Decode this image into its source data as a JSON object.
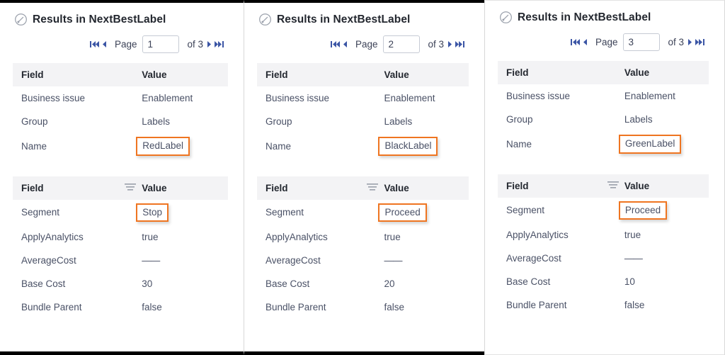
{
  "colors": {
    "highlight_border": "#ef7521",
    "header_bg": "#f3f3f5",
    "accent_blue": "#3b55a5",
    "text": "#4a5166"
  },
  "icons": {
    "gauge": "gauge-icon",
    "filter": "filter-icon",
    "first_page": "first-page-icon",
    "prev_page": "prev-page-icon",
    "next_page": "next-page-icon",
    "last_page": "last-page-icon"
  },
  "pager_common": {
    "page_label": "Page",
    "of_label": "of 3",
    "page_placeholder": ""
  },
  "table_headers": {
    "field": "Field",
    "value": "Value"
  },
  "panels": [
    {
      "title": "Results in NextBestLabel",
      "page_value": "1",
      "top_table": {
        "rows": [
          {
            "field": "Business issue",
            "value": "Enablement",
            "highlight": false
          },
          {
            "field": "Group",
            "value": "Labels",
            "highlight": false
          },
          {
            "field": "Name",
            "value": "RedLabel",
            "highlight": true
          }
        ]
      },
      "bottom_table": {
        "rows": [
          {
            "field": "Segment",
            "value": "Stop",
            "highlight": true
          },
          {
            "field": "ApplyAnalytics",
            "value": "true",
            "highlight": false
          },
          {
            "field": "AverageCost",
            "value": "——",
            "highlight": false
          },
          {
            "field": "Base Cost",
            "value": "30",
            "highlight": false
          },
          {
            "field": "Bundle Parent",
            "value": "false",
            "highlight": false
          }
        ]
      }
    },
    {
      "title": "Results in NextBestLabel",
      "page_value": "2",
      "top_table": {
        "rows": [
          {
            "field": "Business issue",
            "value": "Enablement",
            "highlight": false
          },
          {
            "field": "Group",
            "value": "Labels",
            "highlight": false
          },
          {
            "field": "Name",
            "value": "BlackLabel",
            "highlight": true
          }
        ]
      },
      "bottom_table": {
        "rows": [
          {
            "field": "Segment",
            "value": "Proceed",
            "highlight": true
          },
          {
            "field": "ApplyAnalytics",
            "value": "true",
            "highlight": false
          },
          {
            "field": "AverageCost",
            "value": "——",
            "highlight": false
          },
          {
            "field": "Base Cost",
            "value": "20",
            "highlight": false
          },
          {
            "field": "Bundle Parent",
            "value": "false",
            "highlight": false
          }
        ]
      }
    },
    {
      "title": "Results in NextBestLabel",
      "page_value": "3",
      "top_table": {
        "rows": [
          {
            "field": "Business issue",
            "value": "Enablement",
            "highlight": false
          },
          {
            "field": "Group",
            "value": "Labels",
            "highlight": false
          },
          {
            "field": "Name",
            "value": "GreenLabel",
            "highlight": true
          }
        ]
      },
      "bottom_table": {
        "rows": [
          {
            "field": "Segment",
            "value": "Proceed",
            "highlight": true
          },
          {
            "field": "ApplyAnalytics",
            "value": "true",
            "highlight": false
          },
          {
            "field": "AverageCost",
            "value": "——",
            "highlight": false
          },
          {
            "field": "Base Cost",
            "value": "10",
            "highlight": false
          },
          {
            "field": "Bundle Parent",
            "value": "false",
            "highlight": false
          }
        ]
      }
    }
  ]
}
